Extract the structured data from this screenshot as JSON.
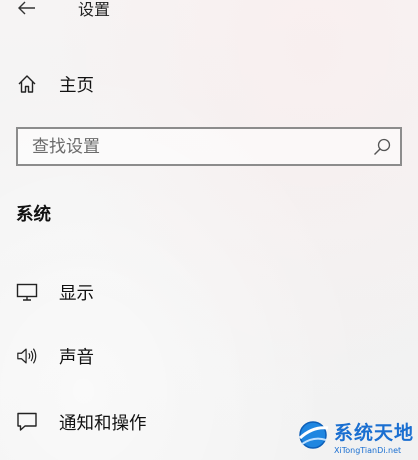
{
  "header": {
    "title": "设置",
    "back_icon": "back-arrow-icon"
  },
  "home": {
    "label": "主页",
    "icon": "home-icon"
  },
  "search": {
    "placeholder": "查找设置",
    "value": "",
    "icon": "search-icon"
  },
  "section": {
    "title": "系统"
  },
  "nav": {
    "items": [
      {
        "label": "显示",
        "icon": "monitor-icon"
      },
      {
        "label": "声音",
        "icon": "speaker-icon"
      },
      {
        "label": "通知和操作",
        "icon": "notification-icon"
      }
    ]
  },
  "watermark": {
    "text": "系统天地",
    "subtext": "XiTongTianDi.net"
  },
  "colors": {
    "accent": "#1a6fd1",
    "text": "#111111",
    "border": "#8c8c8c"
  }
}
